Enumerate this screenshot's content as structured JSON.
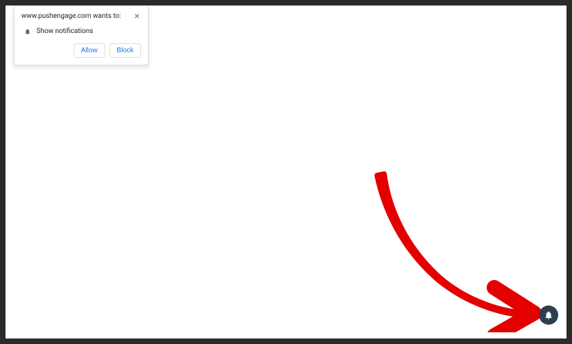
{
  "permission_dialog": {
    "title": "www.pushengage.com wants to:",
    "body_text": "Show notifications",
    "allow_label": "Allow",
    "block_label": "Block",
    "close_label": "×"
  },
  "colors": {
    "arrow": "#e40000",
    "bell_widget_bg": "#2c3e50",
    "link_blue": "#1a73e8"
  }
}
